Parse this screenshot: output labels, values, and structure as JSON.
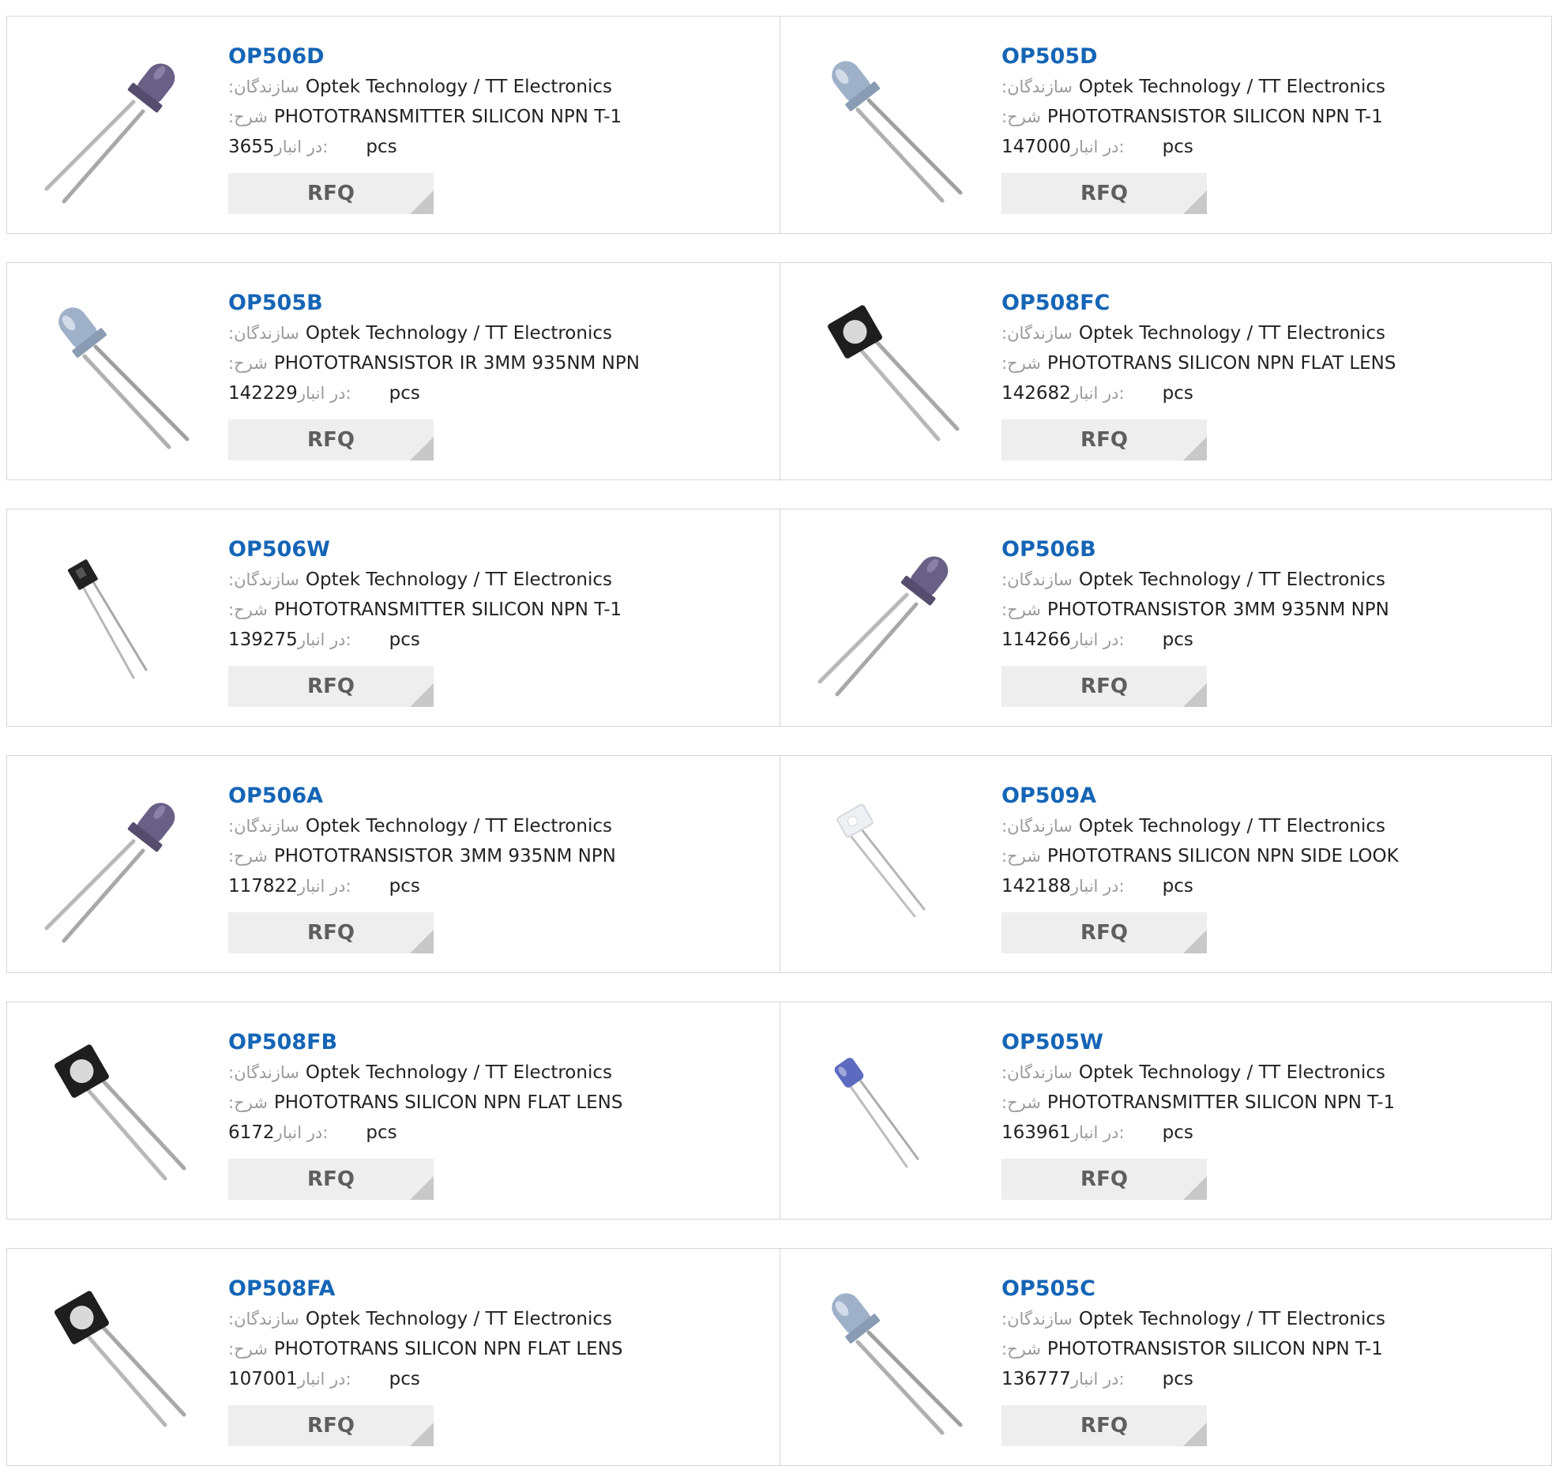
{
  "labels": {
    "manufacturer": ":سازندگان",
    "description": ":شرح",
    "in_stock": "در انبار:",
    "unit": "pcs",
    "rfq": "RFQ"
  },
  "products": [
    {
      "part": "OP506D",
      "manufacturer": "Optek Technology / TT Electronics",
      "description": "PHOTOTRANSMITTER SILICON NPN T-1",
      "stock": "3655",
      "image": "led-purple-5mm-icon"
    },
    {
      "part": "OP505D",
      "manufacturer": "Optek Technology / TT Electronics",
      "description": "PHOTOTRANSISTOR SILICON NPN T-1",
      "stock": "147000",
      "image": "led-clear-5mm-icon"
    },
    {
      "part": "OP505B",
      "manufacturer": "Optek Technology / TT Electronics",
      "description": "PHOTOTRANSISTOR IR 3MM 935NM NPN",
      "stock": "142229",
      "image": "led-clear-5mm-icon"
    },
    {
      "part": "OP508FC",
      "manufacturer": "Optek Technology / TT Electronics",
      "description": "PHOTOTRANS SILICON NPN FLAT LENS",
      "stock": "142682",
      "image": "flat-lens-black-icon"
    },
    {
      "part": "OP506W",
      "manufacturer": "Optek Technology / TT Electronics",
      "description": "PHOTOTRANSMITTER SILICON NPN T-1",
      "stock": "139275",
      "image": "side-look-black-icon"
    },
    {
      "part": "OP506B",
      "manufacturer": "Optek Technology / TT Electronics",
      "description": "PHOTOTRANSISTOR 3MM 935NM NPN",
      "stock": "114266",
      "image": "led-purple-5mm-icon"
    },
    {
      "part": "OP506A",
      "manufacturer": "Optek Technology / TT Electronics",
      "description": "PHOTOTRANSISTOR 3MM 935NM NPN",
      "stock": "117822",
      "image": "led-purple-5mm-icon"
    },
    {
      "part": "OP509A",
      "manufacturer": "Optek Technology / TT Electronics",
      "description": "PHOTOTRANS SILICON NPN SIDE LOOK",
      "stock": "142188",
      "image": "side-look-clear-icon"
    },
    {
      "part": "OP508FB",
      "manufacturer": "Optek Technology / TT Electronics",
      "description": "PHOTOTRANS SILICON NPN FLAT LENS",
      "stock": "6172",
      "image": "flat-lens-black-icon"
    },
    {
      "part": "OP505W",
      "manufacturer": "Optek Technology / TT Electronics",
      "description": "PHOTOTRANSMITTER SILICON NPN T-1",
      "stock": "163961",
      "image": "side-look-blue-icon"
    },
    {
      "part": "OP508FA",
      "manufacturer": "Optek Technology / TT Electronics",
      "description": "PHOTOTRANS SILICON NPN FLAT LENS",
      "stock": "107001",
      "image": "flat-lens-black-icon"
    },
    {
      "part": "OP505C",
      "manufacturer": "Optek Technology / TT Electronics",
      "description": "PHOTOTRANSISTOR SILICON NPN T-1",
      "stock": "136777",
      "image": "led-clear-5mm-icon"
    }
  ],
  "colors": {
    "part_link": "#1565b6",
    "label_gray": "#9a9a9a",
    "button_bg": "#eeeeee",
    "button_text": "#5e5e5e",
    "border": "#d6d6d6"
  }
}
